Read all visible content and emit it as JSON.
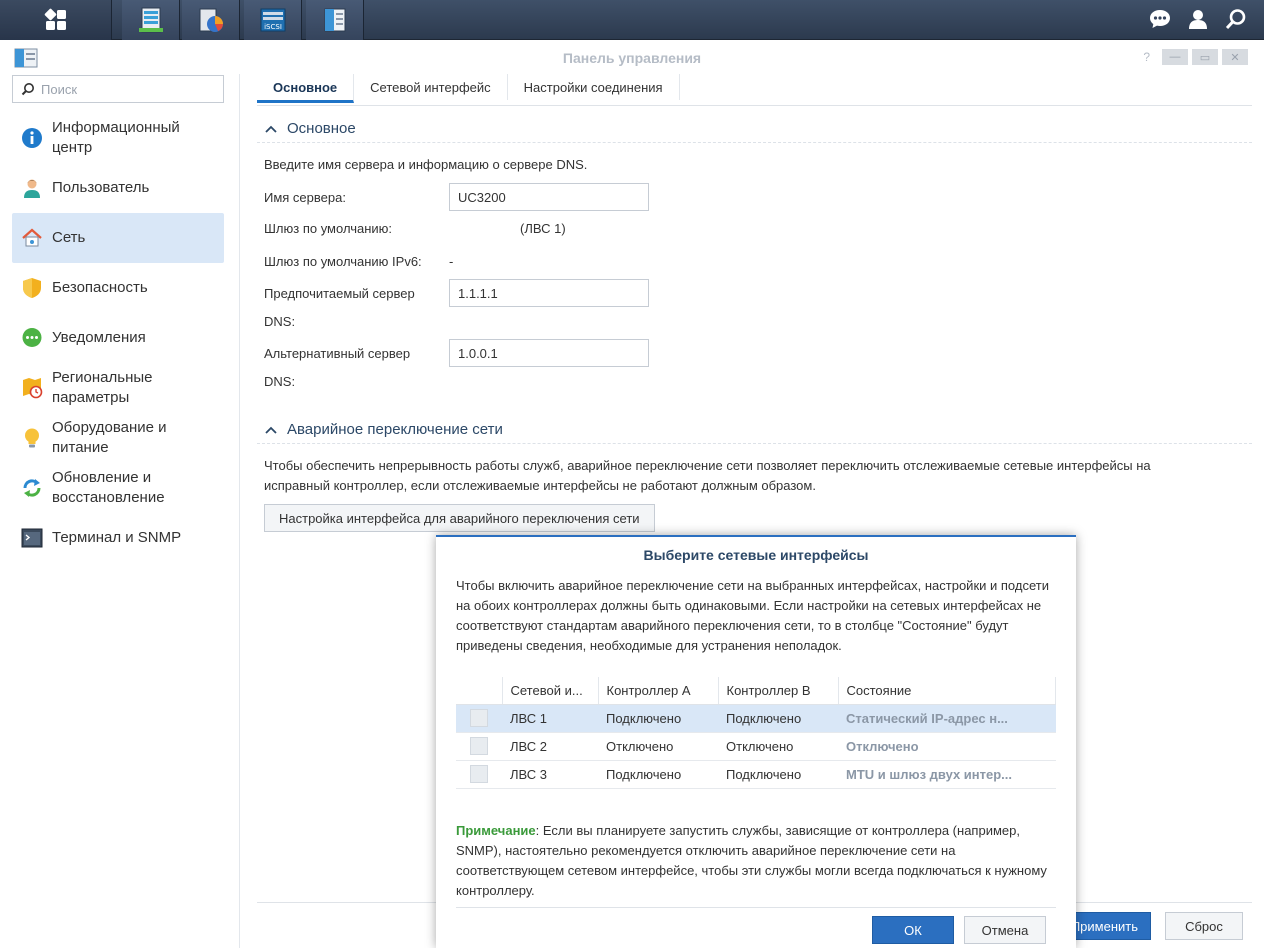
{
  "window": {
    "title": "Панель управления",
    "help": "?"
  },
  "search": {
    "placeholder": "Поиск"
  },
  "sidebar": {
    "items": [
      {
        "label": "Информационный центр",
        "icon": "info-icon"
      },
      {
        "label": "Пользователь",
        "icon": "user-icon"
      },
      {
        "label": "Сеть",
        "icon": "network-home-icon"
      },
      {
        "label": "Безопасность",
        "icon": "shield-icon"
      },
      {
        "label": "Уведомления",
        "icon": "chat-bubble-icon"
      },
      {
        "label": "Региональные параметры",
        "icon": "regional-clock-icon"
      },
      {
        "label": "Оборудование и питание",
        "icon": "lightbulb-icon"
      },
      {
        "label": "Обновление и восстановление",
        "icon": "refresh-icon"
      },
      {
        "label": "Терминал и SNMP",
        "icon": "terminal-icon"
      }
    ]
  },
  "tabs": [
    "Основное",
    "Сетевой интерфейс",
    "Настройки соединения"
  ],
  "general": {
    "heading": "Основное",
    "intro": "Введите имя сервера и информацию о сервере DNS.",
    "server_name_label": "Имя сервера:",
    "server_name_value": "UC3200",
    "gateway_label": "Шлюз по умолчанию:",
    "gateway_value": "(ЛВС 1)",
    "gateway_ipv6_label": "Шлюз по умолчанию IPv6:",
    "gateway_ipv6_value": "-",
    "dns_pref_label_1": "Предпочитаемый сервер",
    "dns_pref_label_2": "DNS:",
    "dns_pref_value": "1.1.1.1",
    "dns_alt_label_1": "Альтернативный сервер",
    "dns_alt_label_2": "DNS:",
    "dns_alt_value": "1.0.0.1"
  },
  "failover": {
    "heading": "Аварийное переключение сети",
    "desc_1": "Чтобы обеспечить непрерывность работы служб, аварийное переключение сети позволяет переключить отслеживаемые сетевые интерфейсы на",
    "desc_2": "исправный контроллер, если отслеживаемые интерфейсы не работают должным образом.",
    "button": "Настройка интерфейса для аварийного переключения сети"
  },
  "footer": {
    "apply": "Применить",
    "reset": "Сброс"
  },
  "modal": {
    "title": "Выберите сетевые интерфейсы",
    "desc": "Чтобы включить аварийное переключение сети на выбранных интерфейсах, настройки и подсети на обоих контроллерах должны быть одинаковыми. Если настройки на сетевых интерфейсах не соответствуют стандартам аварийного переключения сети, то в столбце \"Состояние\" будут приведены сведения, необходимые для устранения неполадок.",
    "columns": [
      "",
      "Сетевой и...",
      "Контроллер A",
      "Контроллер B",
      "Состояние"
    ],
    "rows": [
      {
        "iface": "ЛВС 1",
        "a": "Подключено",
        "b": "Подключено",
        "state": "Статический IP-адрес н..."
      },
      {
        "iface": "ЛВС 2",
        "a": "Отключено",
        "b": "Отключено",
        "state": "Отключено"
      },
      {
        "iface": "ЛВС 3",
        "a": "Подключено",
        "b": "Подключено",
        "state": "MTU и шлюз двух интер..."
      }
    ],
    "note_label": "Примечание",
    "note_text": ": Если вы планируете запустить службы, зависящие от контроллера (например, SNMP), настоятельно рекомендуется отключить аварийное переключение сети на соответствующем сетевом интерфейсе, чтобы эти службы могли всегда подключаться к нужному контроллеру.",
    "ok": "ОК",
    "cancel": "Отмена"
  },
  "colors": {
    "accent": "#2b6fc0",
    "selection": "#d9e7f7",
    "note": "#3a9a3a",
    "taskbar": "#35445c"
  }
}
